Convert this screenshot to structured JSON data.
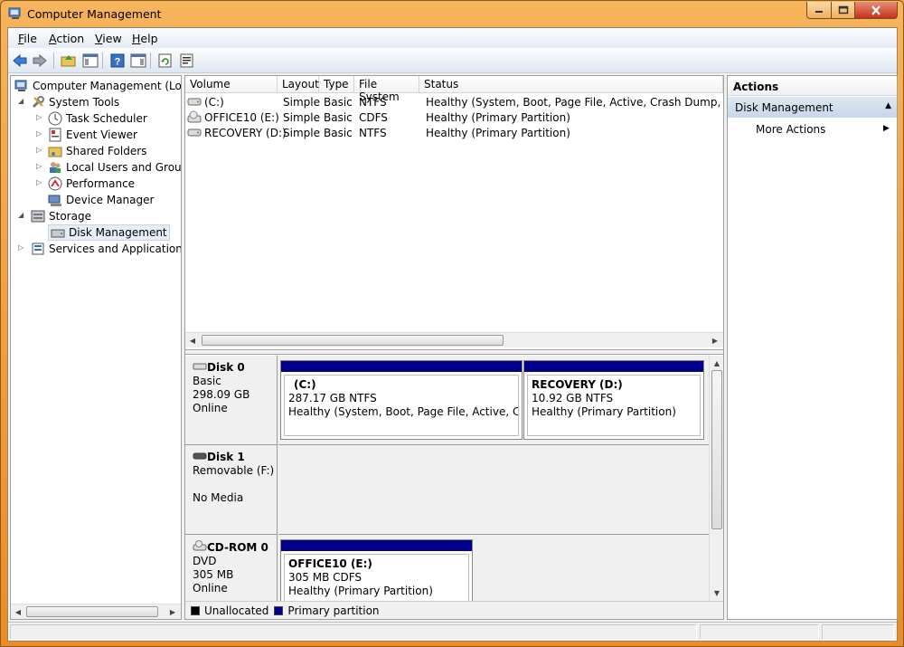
{
  "window": {
    "title": "Computer Management"
  },
  "menu": [
    "File",
    "Action",
    "View",
    "Help"
  ],
  "tree": {
    "root": "Computer Management (Local",
    "items": [
      {
        "label": "System Tools"
      },
      {
        "label": "Task Scheduler"
      },
      {
        "label": "Event Viewer"
      },
      {
        "label": "Shared Folders"
      },
      {
        "label": "Local Users and Groups"
      },
      {
        "label": "Performance"
      },
      {
        "label": "Device Manager"
      },
      {
        "label": "Storage"
      },
      {
        "label": "Disk Management"
      },
      {
        "label": "Services and Applications"
      }
    ]
  },
  "volumes": {
    "columns": [
      "Volume",
      "Layout",
      "Type",
      "File System",
      "Status"
    ],
    "rows": [
      {
        "volume": "(C:)",
        "layout": "Simple",
        "type": "Basic",
        "fs": "NTFS",
        "status": "Healthy (System, Boot, Page File, Active, Crash Dump, Primary"
      },
      {
        "volume": "OFFICE10 (E:)",
        "layout": "Simple",
        "type": "Basic",
        "fs": "CDFS",
        "status": "Healthy (Primary Partition)"
      },
      {
        "volume": "RECOVERY (D:)",
        "layout": "Simple",
        "type": "Basic",
        "fs": "NTFS",
        "status": "Healthy (Primary Partition)"
      }
    ]
  },
  "disks": [
    {
      "name": "Disk 0",
      "kind": "Basic",
      "size": "298.09 GB",
      "state": "Online",
      "partitions": [
        {
          "title": "(C:)",
          "size": "287.17 GB NTFS",
          "status": "Healthy (System, Boot, Page File, Active, Crash D"
        },
        {
          "title": "RECOVERY  (D:)",
          "size": "10.92 GB NTFS",
          "status": "Healthy (Primary Partition)"
        }
      ]
    },
    {
      "name": "Disk 1",
      "kind": "Removable (F:)",
      "size": "",
      "state": "No Media",
      "partitions": []
    },
    {
      "name": "CD-ROM 0",
      "kind": "DVD",
      "size": "305 MB",
      "state": "Online",
      "partitions": [
        {
          "title": "OFFICE10  (E:)",
          "size": "305 MB CDFS",
          "status": "Healthy (Primary Partition)"
        }
      ]
    }
  ],
  "legend": [
    {
      "label": "Unallocated",
      "color": "#000000"
    },
    {
      "label": "Primary partition",
      "color": "#00008b"
    }
  ],
  "actions": {
    "header": "Actions",
    "section": "Disk Management",
    "items": [
      "More Actions"
    ]
  },
  "colors": {
    "accent": "#00008b",
    "frame": "#f0a040"
  }
}
